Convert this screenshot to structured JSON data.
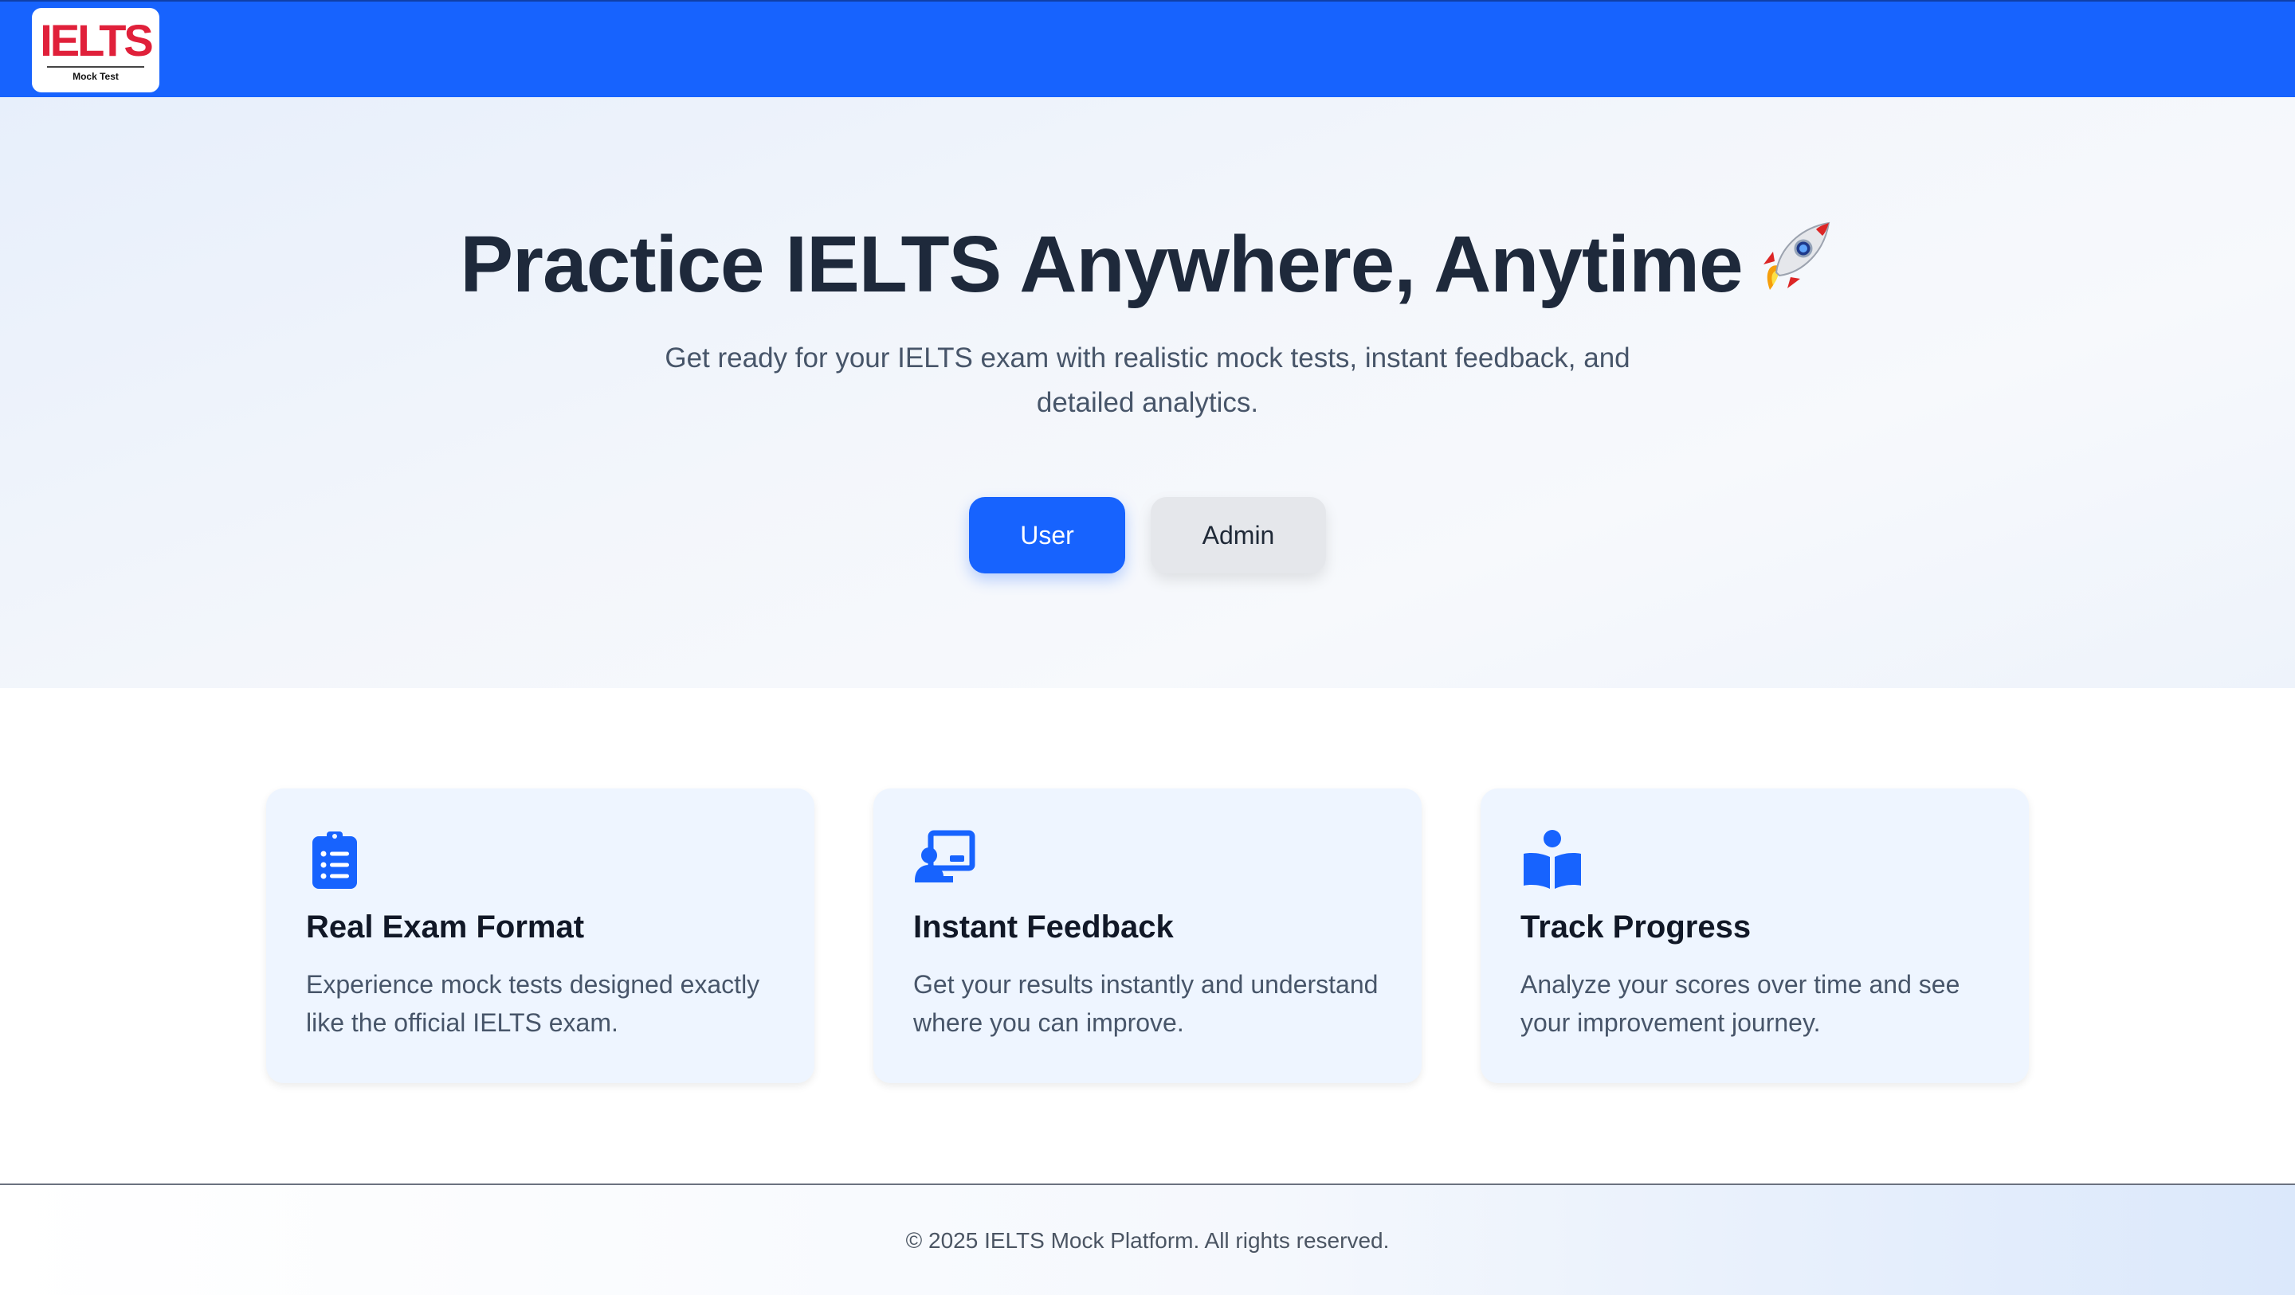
{
  "header": {
    "logo": {
      "main": "IELTS",
      "sub": "Mock Test"
    }
  },
  "hero": {
    "title": "Practice IELTS Anywhere, Anytime",
    "title_icon": "rocket-icon",
    "subtitle": "Get ready for your IELTS exam with realistic mock tests, instant feedback, and detailed analytics.",
    "buttons": {
      "user": "User",
      "admin": "Admin"
    }
  },
  "features": [
    {
      "icon": "clipboard-list-icon",
      "title": "Real Exam Format",
      "text": "Experience mock tests designed exactly like the official IELTS exam."
    },
    {
      "icon": "person-chalkboard-icon",
      "title": "Instant Feedback",
      "text": "Get your results instantly and understand where you can improve."
    },
    {
      "icon": "reader-book-icon",
      "title": "Track Progress",
      "text": "Analyze your scores over time and see your improvement journey."
    }
  ],
  "footer": {
    "text": "© 2025 IELTS Mock Platform. All rights reserved."
  },
  "colors": {
    "primary": "#1763fe",
    "logo_red": "#e0203a",
    "card_bg": "#eef5ff"
  }
}
